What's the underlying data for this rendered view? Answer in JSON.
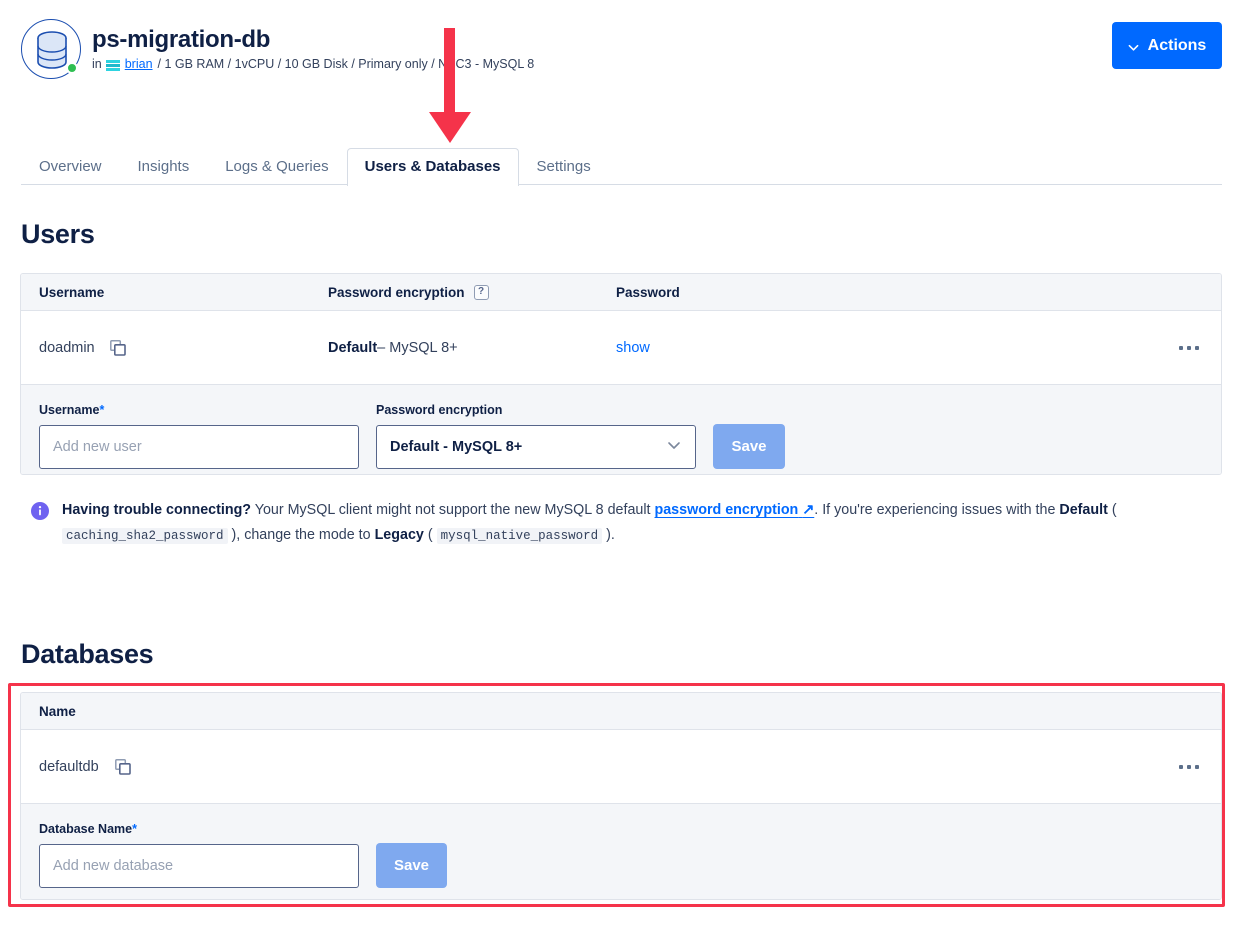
{
  "header": {
    "database_icon": "database-cylinder-icon",
    "status": "online",
    "title": "ps-migration-db",
    "subtitle_prefix": "in",
    "project_icon": "project-icon",
    "project_link": "brian",
    "specs": "/ 1 GB RAM / 1vCPU / 10 GB Disk / Primary only / NYC3 - MySQL 8",
    "actions_label": "Actions",
    "actions_icon": "chevron-down-icon"
  },
  "tabs": [
    {
      "label": "Overview",
      "active": false
    },
    {
      "label": "Insights",
      "active": false
    },
    {
      "label": "Logs & Queries",
      "active": false
    },
    {
      "label": "Users & Databases",
      "active": true
    },
    {
      "label": "Settings",
      "active": false
    }
  ],
  "users": {
    "section_title": "Users",
    "columns": {
      "username": "Username",
      "encryption": "Password encryption",
      "encryption_help": "?",
      "password": "Password"
    },
    "rows": [
      {
        "username": "doadmin",
        "copy_icon": "copy-icon",
        "encryption_mode": "Default",
        "encryption_detail": "– MySQL 8+",
        "password_action": "show",
        "menu_icon": "kebab-menu-icon"
      }
    ],
    "form": {
      "username_label": "Username",
      "required_mark": "*",
      "username_placeholder": "Add new user",
      "username_value": "",
      "encryption_label": "Password encryption",
      "encryption_value": "Default - MySQL 8+",
      "encryption_icon": "chevron-down-icon",
      "save_label": "Save"
    }
  },
  "notice": {
    "icon": "info-icon",
    "lead": "Having trouble connecting?",
    "text_1": " Your MySQL client might not support the new MySQL 8 default ",
    "link": "password encryption",
    "link_icon": "external-link-icon",
    "text_2": ". If you're experiencing issues with the ",
    "bold_default": "Default",
    "text_3": " ( ",
    "code_1": "caching_sha2_password",
    "text_4": " ), change the mode to ",
    "bold_legacy": "Legacy",
    "text_5": " ( ",
    "code_2": "mysql_native_password",
    "text_6": " )."
  },
  "databases": {
    "section_title": "Databases",
    "columns": {
      "name": "Name"
    },
    "rows": [
      {
        "name": "defaultdb",
        "copy_icon": "copy-icon",
        "menu_icon": "kebab-menu-icon"
      }
    ],
    "form": {
      "name_label": "Database Name",
      "required_mark": "*",
      "name_placeholder": "Add new database",
      "name_value": "",
      "save_label": "Save"
    }
  },
  "annotations": {
    "highlight_color": "#f5334a",
    "arrow_target": "Users & Databases tab",
    "rect_target": "Databases table"
  },
  "colors": {
    "brand_blue": "#0069ff",
    "navy": "#0f2045",
    "status_green": "#2fbf52",
    "disabled_blue": "#7fa9ef",
    "annotation_red": "#f5334a"
  }
}
